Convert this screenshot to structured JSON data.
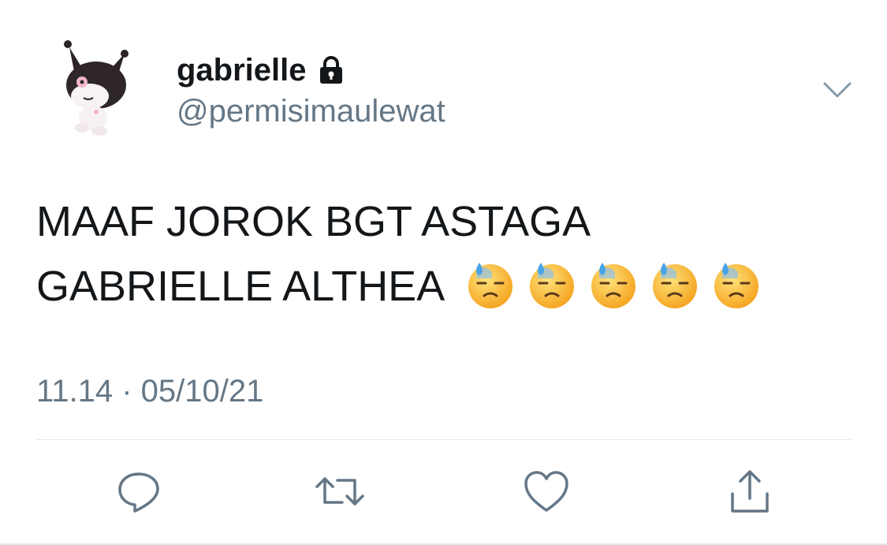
{
  "tweet": {
    "display_name": "gabrielle",
    "handle": "@permisimaulewat",
    "text_line1": "MAAF JOROK BGT ASTAGA",
    "text_line2": "GABRIELLE ALTHEA",
    "emojis": [
      "downcast-face-with-sweat",
      "downcast-face-with-sweat",
      "downcast-face-with-sweat",
      "downcast-face-with-sweat",
      "downcast-face-with-sweat"
    ],
    "timestamp": "11.14 · 05/10/21",
    "account_locked": true
  },
  "icons": {
    "lock": "lock-icon",
    "caret": "chevron-down-icon",
    "reply": "reply-icon",
    "retweet": "retweet-icon",
    "like": "heart-icon",
    "share": "share-icon"
  },
  "colors": {
    "primary_text": "#14171a",
    "secondary_text": "#657786",
    "divider": "#e1e8ed",
    "icon": "#657786"
  }
}
